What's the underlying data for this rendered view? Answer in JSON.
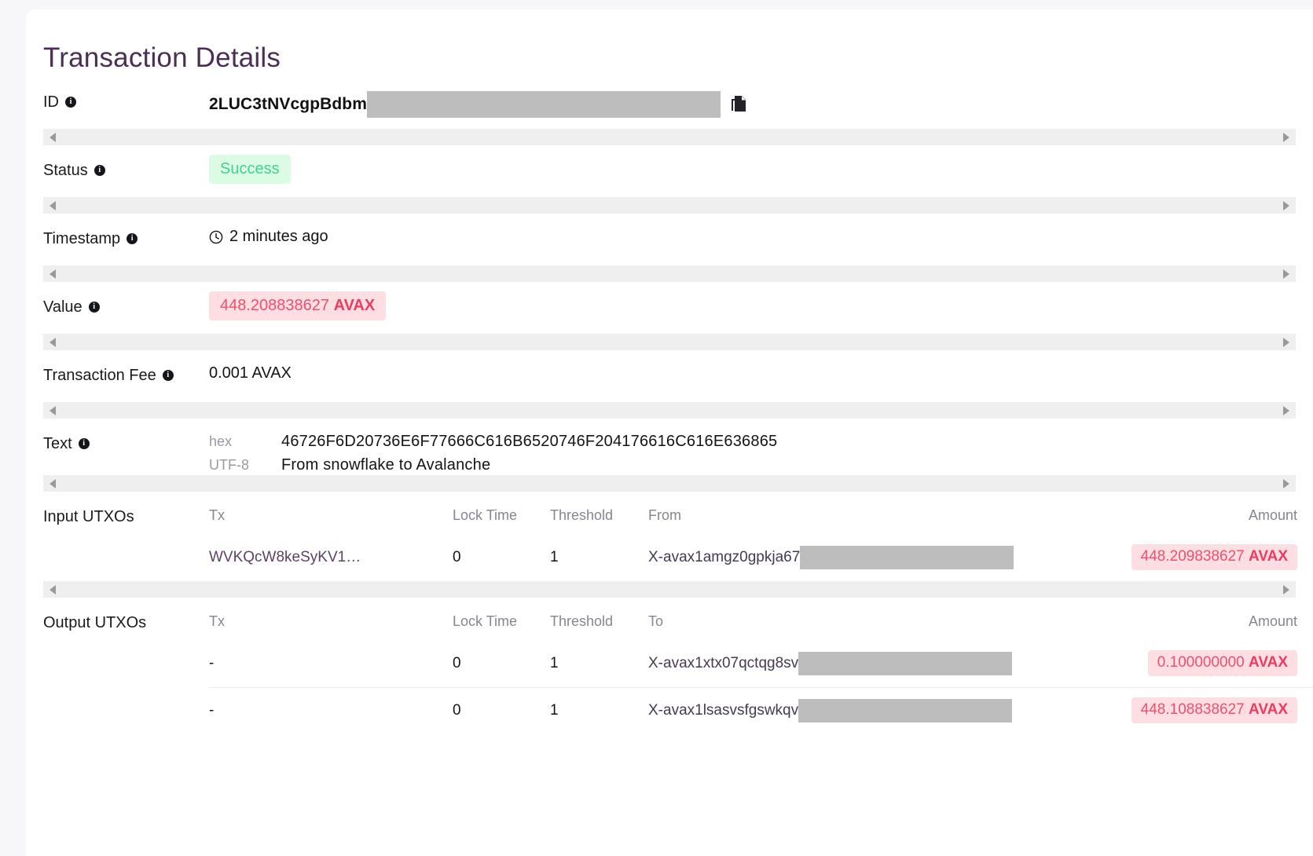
{
  "page": {
    "title": "Transaction Details"
  },
  "icons": {
    "info": "info-icon",
    "copy": "copy-icon",
    "clock": "clock-icon",
    "scroll_left": "arrow-left-icon",
    "scroll_right": "arrow-right-icon"
  },
  "colors": {
    "title": "#4b2e55",
    "success_text": "#3dd68c",
    "success_bg": "#dcfbe4",
    "avax_text": "#f0506e",
    "avax_bg": "#fddee3",
    "link": "#5d4266",
    "muted": "#9a9aa2",
    "redaction": "#bdbdbd"
  },
  "fields": {
    "id": {
      "label": "ID",
      "value": "2LUC3tNVcgpBdbm",
      "redacted": true
    },
    "status": {
      "label": "Status",
      "value": "Success"
    },
    "timestamp": {
      "label": "Timestamp",
      "value": "2 minutes ago"
    },
    "value": {
      "label": "Value",
      "amount": "448.208838627",
      "unit": "AVAX"
    },
    "transaction_fee": {
      "label": "Transaction Fee",
      "value": "0.001 AVAX"
    },
    "text": {
      "label": "Text",
      "hex_key": "hex",
      "hex_value": "46726F6D20736E6F77666C616B6520746F204176616C616E636865",
      "utf8_key": "UTF-8",
      "utf8_value": "From snowflake to Avalanche"
    }
  },
  "input_utxos": {
    "label": "Input UTXOs",
    "columns": {
      "tx": "Tx",
      "lock_time": "Lock Time",
      "threshold": "Threshold",
      "address": "From",
      "amount": "Amount"
    },
    "rows": [
      {
        "tx": "WVKQcW8keSyKV1…",
        "lock_time": "0",
        "threshold": "1",
        "address": "X-avax1amgz0gpkja67",
        "amount": "448.209838627",
        "unit": "AVAX"
      }
    ]
  },
  "output_utxos": {
    "label": "Output UTXOs",
    "columns": {
      "tx": "Tx",
      "lock_time": "Lock Time",
      "threshold": "Threshold",
      "address": "To",
      "amount": "Amount"
    },
    "rows": [
      {
        "tx": "-",
        "lock_time": "0",
        "threshold": "1",
        "address": "X-avax1xtx07qctqg8sv",
        "amount": "0.100000000",
        "unit": "AVAX"
      },
      {
        "tx": "-",
        "lock_time": "0",
        "threshold": "1",
        "address": "X-avax1lsasvsfgswkqv",
        "amount": "448.108838627",
        "unit": "AVAX"
      }
    ]
  }
}
